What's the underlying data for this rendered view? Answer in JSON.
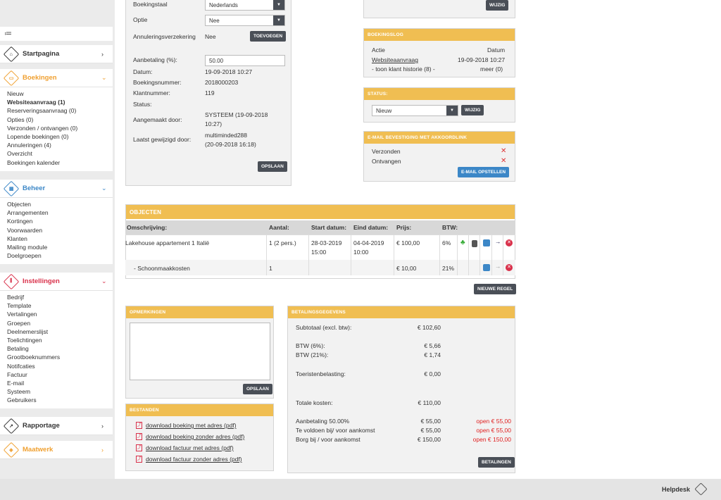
{
  "sidebar": {
    "toggle_icon": "≔",
    "sections": [
      {
        "title": "Startpagina",
        "color": "#333",
        "icon": "home-icon",
        "glyph": "⌂",
        "chev": "›"
      },
      {
        "title": "Boekingen",
        "color": "#f0a030",
        "icon": "bookings-icon",
        "glyph": "▭",
        "chev": "⌄",
        "items": [
          "Nieuw",
          "Websiteaanvraag (1)",
          "Reserveringsaanvraag (0)",
          "Opties (0)",
          "Verzonden / ontvangen (0)",
          "Lopende boekingen (0)",
          "Annuleringen (4)",
          "Overzicht",
          "Boekingen kalender"
        ]
      },
      {
        "title": "Beheer",
        "color": "#3c87c7",
        "icon": "manage-icon",
        "glyph": "▦",
        "chev": "⌄",
        "items": [
          "Objecten",
          "Arrangementen",
          "Kortingen",
          "Voorwaarden",
          "Klanten",
          "Mailing module",
          "Doelgroepen"
        ]
      },
      {
        "title": "Instellingen",
        "color": "#d9304a",
        "icon": "settings-icon",
        "glyph": "⫼",
        "chev": "⌄",
        "items": [
          "Bedrijf",
          "Template",
          "Vertalingen",
          "Groepen",
          "Deelnemerslijst",
          "Toelichtingen",
          "Betaling",
          "Grootboeknummers",
          "Notifcaties",
          "Factuur",
          "E-mail",
          "Systeem",
          "Gebruikers"
        ]
      },
      {
        "title": "Rapportage",
        "color": "#333",
        "icon": "chart-icon",
        "glyph": "↗",
        "chev": "›"
      },
      {
        "title": "Maatwerk",
        "color": "#f0a030",
        "icon": "custom-icon",
        "glyph": "◈",
        "chev": "›"
      }
    ]
  },
  "booking": {
    "taal_label": "Boekingstaal",
    "taal_value": "Nederlands",
    "optie_label": "Optie",
    "optie_value": "Nee",
    "annul_label": "Annuleringsverzekering",
    "annul_value": "Nee",
    "add_btn": "TOEVOEGEN",
    "aanbet_label": "Aanbetaling (%):",
    "aanbet_value": "50.00",
    "datum_label": "Datum:",
    "datum_value": "19-09-2018 10:27",
    "nummer_label": "Boekingsnummer:",
    "nummer_value": "2018000203",
    "klant_label": "Klantnummer:",
    "klant_value": "119",
    "status_label": "Status:",
    "aangemaakt_label": "Aangemaakt door:",
    "aangemaakt_v1": "SYSTEEM (19-09-2018",
    "aangemaakt_v2": "10:27)",
    "gewijzigd_label": "Laatst gewijzigd door:",
    "gewijzigd_v1": "multiminded288",
    "gewijzigd_v2": "(20-09-2018 16:18)",
    "save_btn": "OPSLAAN"
  },
  "top_right_btn": "WIJZIG",
  "log": {
    "title": "BOEKINGSLOG",
    "col1": "Actie",
    "col2": "Datum",
    "row1_a": "Websiteaanvraag",
    "row1_d": "19-09-2018 10:27",
    "row2_a": "- toon klant historie (8) -",
    "row2_d": "meer (0)"
  },
  "status": {
    "title": "STATUS:",
    "value": "Nieuw",
    "btn": "WIJZIG"
  },
  "email": {
    "title": "E-MAIL BEVESTIGING MET AKKOORDLINK",
    "r1": "Verzonden",
    "r2": "Ontvangen",
    "btn": "E-MAIL OPSTELLEN"
  },
  "objecten": {
    "title": "OBJECTEN",
    "headers": [
      "Omschrijving:",
      "Aantal:",
      "Start datum:",
      "Eind datum:",
      "Prijs:",
      "BTW:"
    ],
    "rows": [
      {
        "desc": "Lakehouse appartement 1 Italië",
        "aantal": "1 (2 pers.)",
        "start1": "28-03-2019",
        "start2": "15:00",
        "eind1": "04-04-2019",
        "eind2": "10:00",
        "prijs": "€ 100,00",
        "btw": "6%"
      },
      {
        "desc": "- Schoonmaakkosten",
        "aantal": "1",
        "start1": "",
        "start2": "",
        "eind1": "",
        "eind2": "",
        "prijs": "€ 10,00",
        "btw": "21%"
      }
    ],
    "new_btn": "NIEUWE REGEL"
  },
  "opmerkingen": {
    "title": "OPMERKINGEN",
    "btn": "OPSLAAN"
  },
  "bestanden": {
    "title": "BESTANDEN",
    "links": [
      "download boeking met adres (pdf)",
      "download boeking zonder adres (pdf)",
      "download factuur met adres (pdf)",
      "download factuur zonder adres (pdf)"
    ]
  },
  "betaling": {
    "title": "BETALINGSGEGEVENS",
    "subtotaal_l": "Subtotaal (excl. btw):",
    "subtotaal_v": "€ 102,60",
    "btw6_l": "BTW (6%):",
    "btw6_v": "€ 5,66",
    "btw21_l": "BTW (21%):",
    "btw21_v": "€ 1,74",
    "toer_l": "Toeristenbelasting:",
    "toer_v": "€ 0,00",
    "totaal_l": "Totale kosten:",
    "totaal_v": "€ 110,00",
    "aanbet_l": "Aanbetaling 50.00%",
    "aanbet_v": "€ 55,00",
    "aanbet_o": "open € 55,00",
    "voldoen_l": "Te voldoen bij/ voor aankomst",
    "voldoen_v": "€ 55,00",
    "voldoen_o": "open € 55,00",
    "borg_l": "Borg bij / voor aankomst",
    "borg_v": "€ 150,00",
    "borg_o": "open € 150,00",
    "btn": "BETALINGEN"
  },
  "footer": {
    "helpdesk": "Helpdesk"
  }
}
